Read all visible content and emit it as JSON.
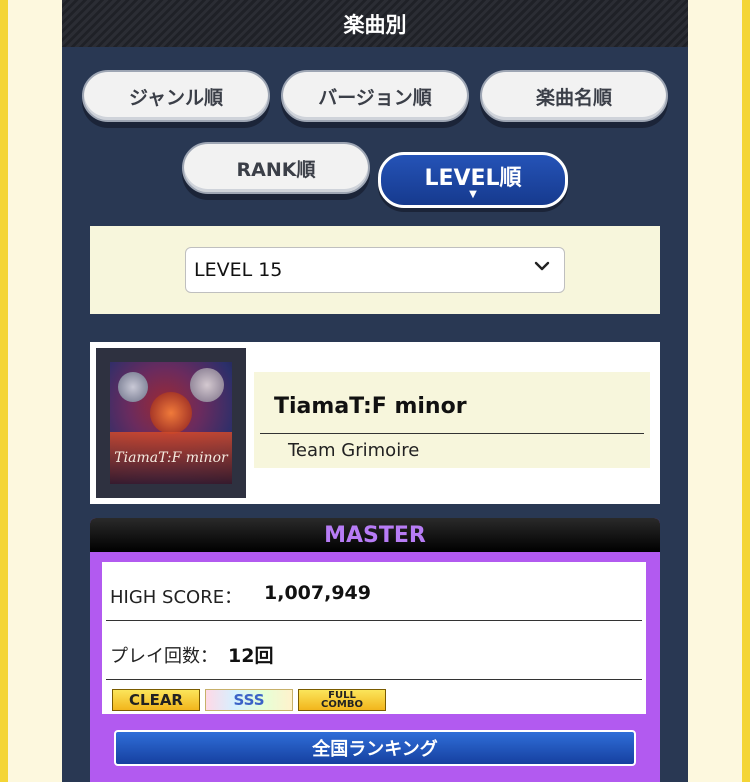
{
  "header": {
    "title": "楽曲別"
  },
  "sort_buttons": [
    {
      "label": "ジャンル順"
    },
    {
      "label": "バージョン順"
    },
    {
      "label": "楽曲名順"
    },
    {
      "label": "RANK順"
    },
    {
      "label": "LEVEL順",
      "active": true
    }
  ],
  "active_indicator": "▼",
  "level_filter": {
    "selected": "LEVEL 15"
  },
  "song": {
    "title": "TiamaT:F minor",
    "artist": "Team Grimoire",
    "jacket_logo_text": "TiamaT:F minor"
  },
  "difficulty": {
    "name": "MASTER",
    "high_score_label": "HIGH SCORE：",
    "high_score_value": "1,007,949",
    "play_count_label": "プレイ回数：",
    "play_count_value": "12回",
    "badges": {
      "clear": "CLEAR",
      "rank": "SSS",
      "combo_line1": "FULL",
      "combo_line2": "COMBO"
    },
    "ranking_button": "全国ランキング"
  },
  "colors": {
    "panel": "#293853",
    "master_accent": "#b25af0",
    "active_button": "#1d47a5"
  }
}
